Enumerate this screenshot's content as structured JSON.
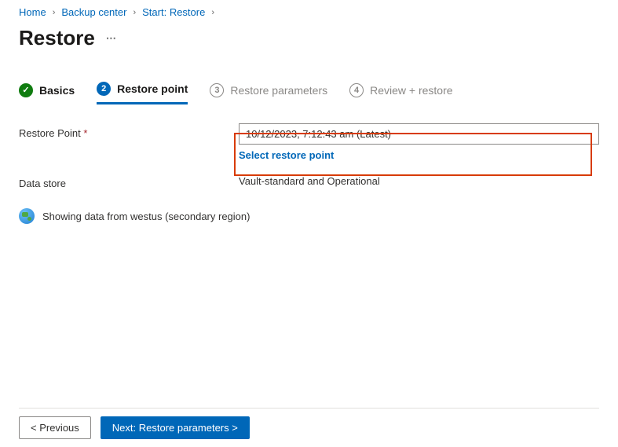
{
  "breadcrumb": {
    "home": "Home",
    "backup_center": "Backup center",
    "start_restore": "Start: Restore"
  },
  "title": "Restore",
  "tabs": {
    "basics": "Basics",
    "restore_point": "Restore point",
    "restore_parameters": "Restore parameters",
    "review_restore": "Review + restore",
    "num2": "2",
    "num3": "3",
    "num4": "4"
  },
  "form": {
    "restore_point_label": "Restore Point",
    "restore_point_value": "10/12/2023, 7:12:43 am (Latest)",
    "select_restore_point": "Select restore point",
    "data_store_label": "Data store",
    "data_store_value": "Vault-standard and Operational"
  },
  "region_notice": "Showing data from westus (secondary region)",
  "footer": {
    "previous": "< Previous",
    "next": "Next: Restore parameters >"
  }
}
